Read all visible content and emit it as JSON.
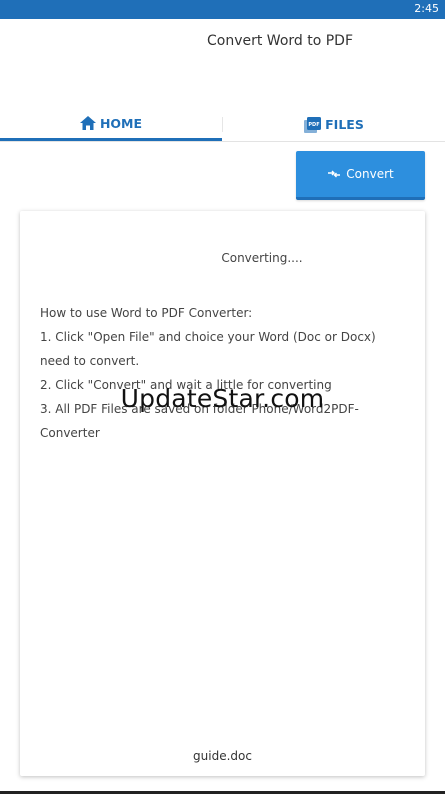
{
  "status_bar": {
    "time": "2:45"
  },
  "app": {
    "title": "Convert Word to PDF"
  },
  "tabs": [
    {
      "label": "HOME",
      "icon": "home-icon",
      "active": true
    },
    {
      "label": "FILES",
      "icon": "pdf-file-icon",
      "active": false
    }
  ],
  "toolbar": {
    "convert_label": "Convert",
    "icon": "convert-arrows-icon"
  },
  "card": {
    "status": "Converting....",
    "instructions": [
      "How to use Word to PDF Converter:",
      "1. Click \"Open File\" and choice your Word (Doc or Docx) need to convert.",
      "2. Click \"Convert\" and wait a little for converting",
      "3. All PDF Files are saved on folder Phone/Word2PDF-Converter"
    ],
    "file_name": "guide.doc"
  },
  "watermark": "UpdateStar.com",
  "colors": {
    "primary": "#1f6fb8",
    "button": "#2d8fde"
  }
}
